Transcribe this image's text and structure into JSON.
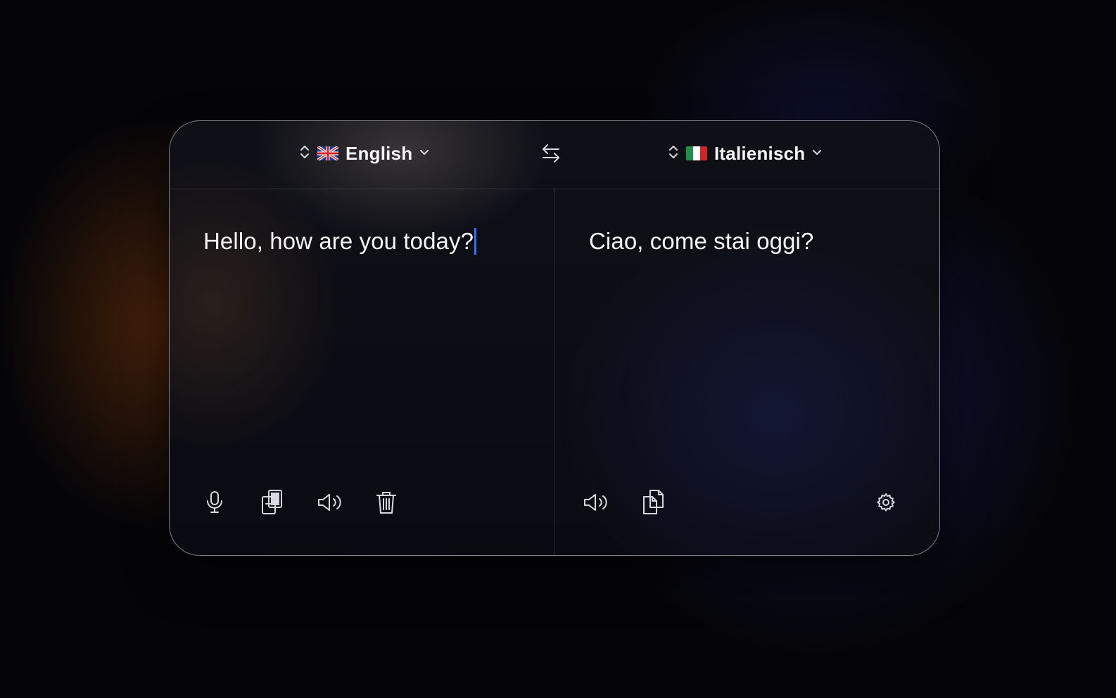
{
  "source": {
    "language": "English",
    "flag": "uk-flag-icon",
    "text": "Hello, how are you today?"
  },
  "target": {
    "language": "Italienisch",
    "flag": "italy-flag-icon",
    "text": "Ciao, come stai oggi?"
  },
  "icons": {
    "sort": "sort-arrows-icon",
    "chevron": "chevron-down-icon",
    "swap": "swap-arrows-icon",
    "microphone": "microphone-icon",
    "paste": "paste-icon",
    "speaker": "speaker-icon",
    "trash": "trash-icon",
    "copy": "copy-icon",
    "settings": "gear-icon"
  },
  "colors": {
    "caret": "#3b6cf6",
    "text": "#f5f5f7",
    "icon": "#d8d8de"
  }
}
